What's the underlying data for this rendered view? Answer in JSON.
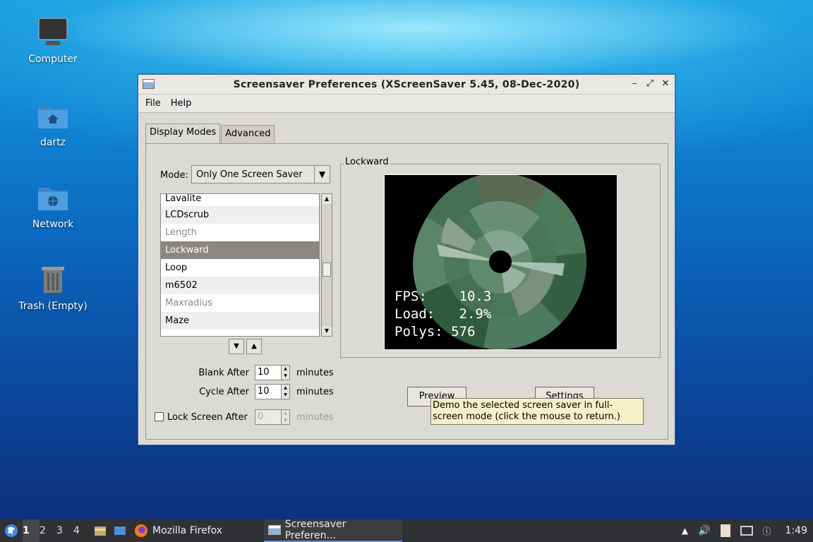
{
  "desktop": {
    "icons": [
      {
        "label": "Computer"
      },
      {
        "label": "dartz"
      },
      {
        "label": "Network"
      },
      {
        "label": "Trash (Empty)"
      }
    ]
  },
  "window": {
    "title": "Screensaver Preferences  (XScreenSaver 5.45, 08-Dec-2020)",
    "menu": {
      "file": "File",
      "help": "Help"
    },
    "tabs": {
      "display_modes": "Display Modes",
      "advanced": "Advanced"
    },
    "mode": {
      "label": "Mode:",
      "value": "Only One Screen Saver"
    },
    "list": {
      "items": [
        {
          "label": "Lavalite",
          "state": "normal"
        },
        {
          "label": "LCDscrub",
          "state": "normal"
        },
        {
          "label": "Length",
          "state": "disabled"
        },
        {
          "label": "Lockward",
          "state": "selected"
        },
        {
          "label": "Loop",
          "state": "normal"
        },
        {
          "label": "m6502",
          "state": "normal"
        },
        {
          "label": "Maxradius",
          "state": "disabled"
        },
        {
          "label": "Maze",
          "state": "normal"
        }
      ]
    },
    "blank_after": {
      "label": "Blank After",
      "value": "10",
      "units": "minutes"
    },
    "cycle_after": {
      "label": "Cycle After",
      "value": "10",
      "units": "minutes"
    },
    "lock_after": {
      "label": "Lock Screen After",
      "value": "0",
      "units": "minutes",
      "checked": false
    },
    "preview": {
      "legend": "Lockward",
      "fps_label": "FPS:",
      "fps_value": "10.3",
      "load_label": "Load:",
      "load_value": "2.9%",
      "polys_label": "Polys:",
      "polys_value": "576"
    },
    "buttons": {
      "preview": "Preview",
      "settings": "Settings"
    },
    "tooltip": "Demo the selected screen saver in full-screen mode (click the mouse to return.)"
  },
  "taskbar": {
    "workspaces": [
      "1",
      "2",
      "3",
      "4"
    ],
    "tasks": [
      {
        "label": "Mozilla Firefox"
      },
      {
        "label": "Screensaver Preferen..."
      }
    ],
    "clock": "1:49"
  }
}
